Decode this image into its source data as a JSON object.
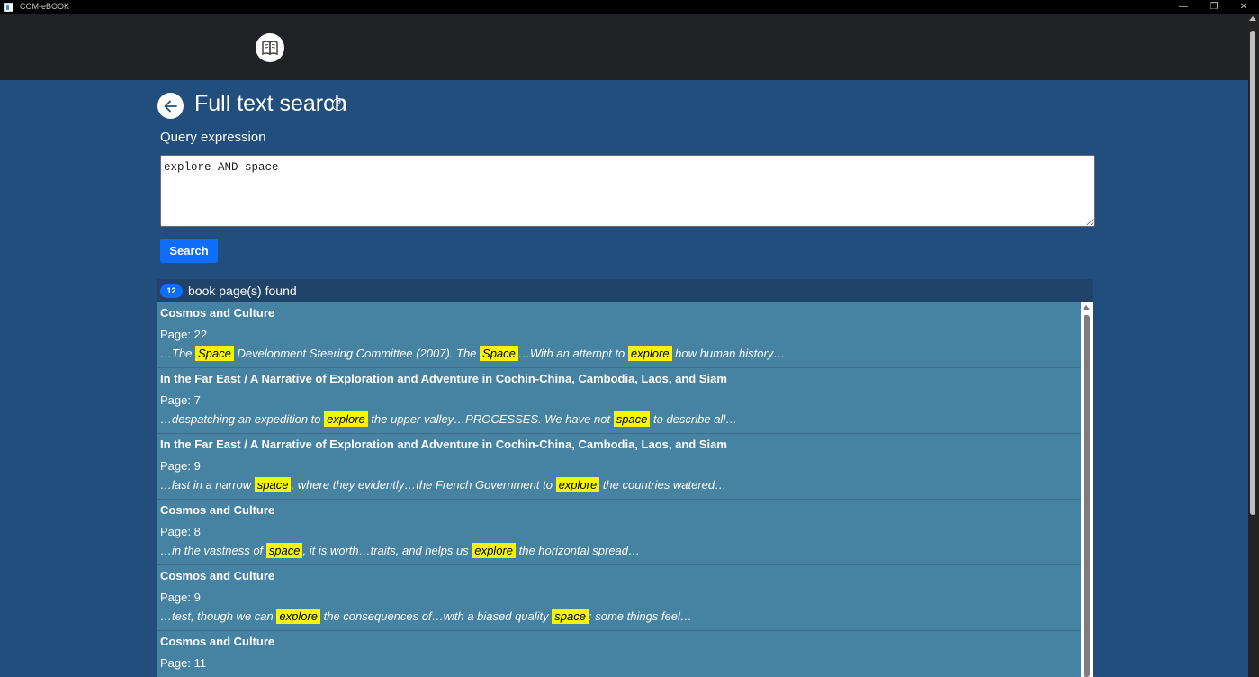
{
  "window": {
    "title": "COM-eBOOK",
    "minimize": "—",
    "maximize": "❐",
    "close": "✕"
  },
  "page": {
    "title": "Full text search",
    "help": "?",
    "query_label": "Query expression",
    "query_value": "explore AND space",
    "search_button": "Search"
  },
  "results": {
    "count": "12",
    "found_label": "book page(s) found",
    "items": [
      {
        "title": "Cosmos and Culture",
        "page": "Page: 22",
        "snippet": [
          {
            "t": "…The "
          },
          {
            "h": "Space"
          },
          {
            "t": " Development Steering Committee (2007). The "
          },
          {
            "h": "Space"
          },
          {
            "t": "…With an attempt to "
          },
          {
            "h": "explore"
          },
          {
            "t": " how human history…"
          }
        ]
      },
      {
        "title": "In the Far East / A Narrative of Exploration and Adventure in Cochin-China, Cambodia, Laos, and Siam",
        "page": "Page: 7",
        "snippet": [
          {
            "t": "…despatching an expedition to "
          },
          {
            "h": "explore"
          },
          {
            "t": " the upper valley…PROCESSES. We have not "
          },
          {
            "h": "space"
          },
          {
            "t": " to describe all…"
          }
        ]
      },
      {
        "title": "In the Far East / A Narrative of Exploration and Adventure in Cochin-China, Cambodia, Laos, and Siam",
        "page": "Page: 9",
        "snippet": [
          {
            "t": "…last in a narrow "
          },
          {
            "h": "space"
          },
          {
            "t": ", where they evidently…the French Government to "
          },
          {
            "h": "explore"
          },
          {
            "t": " the countries watered…"
          }
        ]
      },
      {
        "title": "Cosmos and Culture",
        "page": "Page: 8",
        "snippet": [
          {
            "t": "…in the vastness of "
          },
          {
            "h": "space"
          },
          {
            "t": ", it is worth…traits, and helps us "
          },
          {
            "h": "explore"
          },
          {
            "t": " the horizontal spread…"
          }
        ]
      },
      {
        "title": "Cosmos and Culture",
        "page": "Page: 9",
        "snippet": [
          {
            "t": "…test, though we can "
          },
          {
            "h": "explore"
          },
          {
            "t": " the consequences of…with a biased quality "
          },
          {
            "h": "space"
          },
          {
            "t": ": some things feel…"
          }
        ]
      },
      {
        "title": "Cosmos and Culture",
        "page": "Page: 11",
        "snippet": []
      }
    ]
  },
  "colors": {
    "background": "#224e7e",
    "header": "#202125",
    "result_bg": "#4682a1",
    "highlight": "#f6f600",
    "accent": "#0d6efd"
  },
  "icons": {
    "library": "book-icon",
    "back": "arrow-left-icon",
    "help": "question-circle-icon"
  }
}
